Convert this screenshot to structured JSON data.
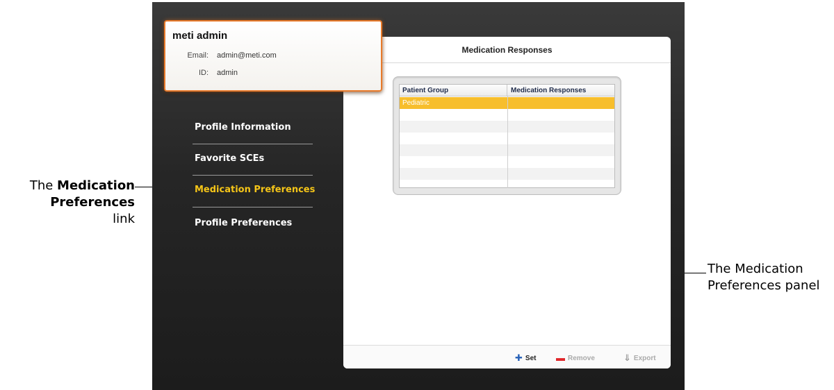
{
  "annotations": {
    "left_prefix": "The",
    "left_bold": "Medication Preferences",
    "left_suffix": "link",
    "right_text": "The Medication Preferences panel"
  },
  "profile": {
    "name": "meti admin",
    "email_label": "Email:",
    "email": "admin@meti.com",
    "id_label": "ID:",
    "id": "admin"
  },
  "nav": {
    "items": [
      {
        "label": "Profile Information",
        "active": false
      },
      {
        "label": "Favorite SCEs",
        "active": false
      },
      {
        "label": "Medication Preferences",
        "active": true
      },
      {
        "label": "Profile Preferences",
        "active": false
      }
    ]
  },
  "panel": {
    "title": "Medication Responses",
    "table": {
      "columns": [
        "Patient Group",
        "Medication Responses"
      ],
      "rows": [
        [
          "Pediatric",
          ""
        ]
      ],
      "selected_row": 0
    },
    "footer": {
      "set_label": "Set",
      "remove_label": "Remove",
      "export_label": "Export"
    }
  },
  "colors": {
    "accent_orange": "#e87a2a",
    "active_nav": "#f5c518",
    "selected_row": "#f7be2c"
  }
}
